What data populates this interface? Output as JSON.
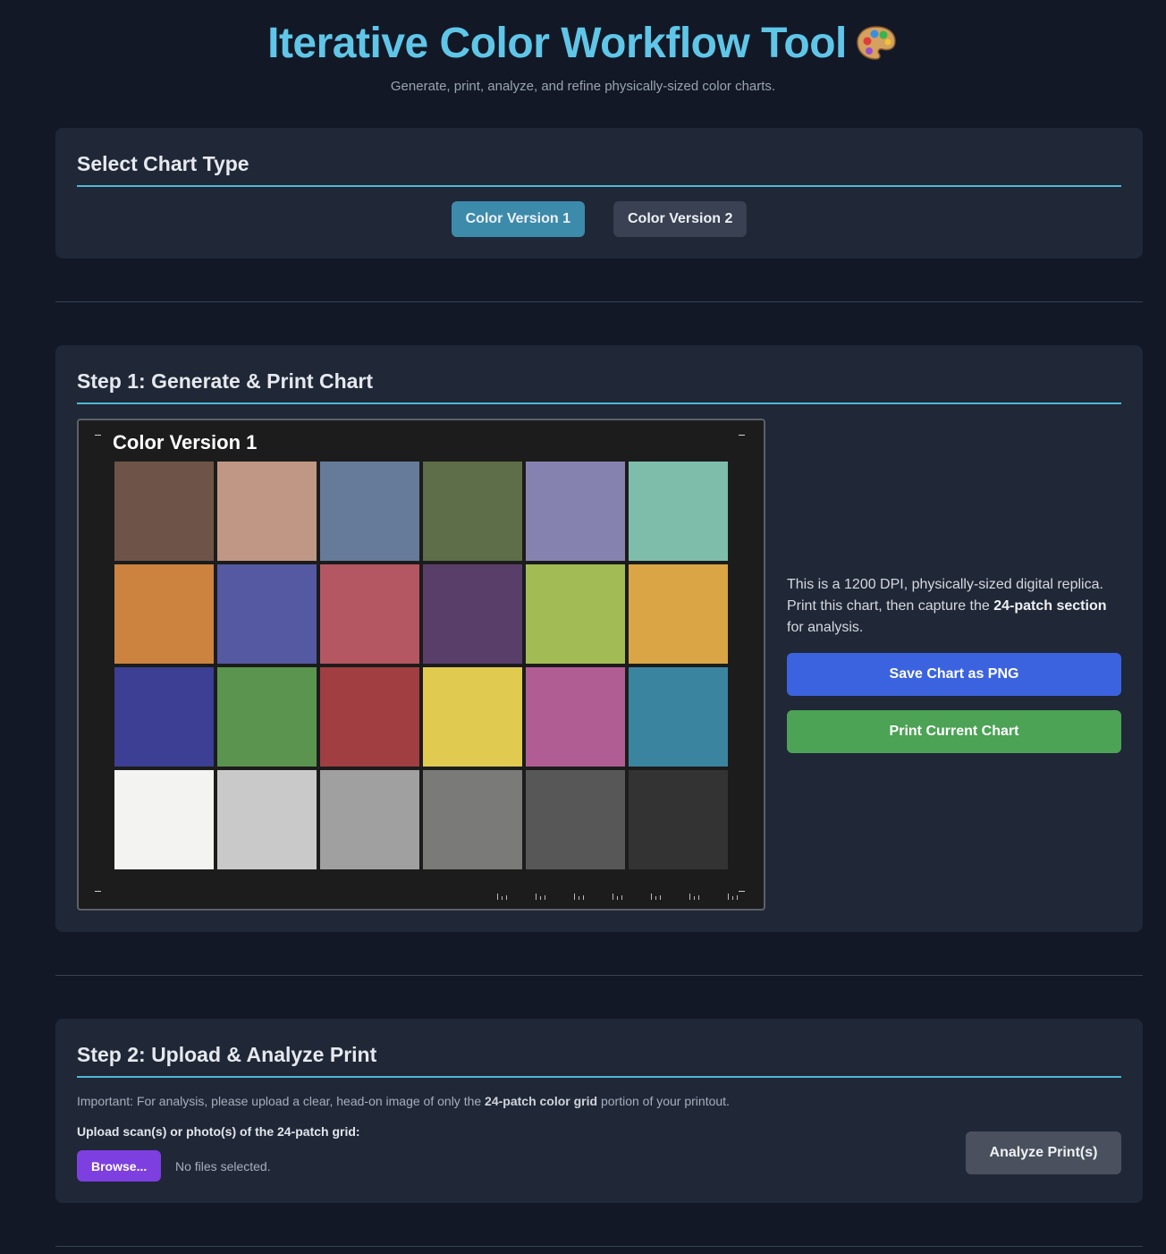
{
  "header": {
    "title": "Iterative Color Workflow Tool",
    "title_icon": "palette-icon",
    "subtitle": "Generate, print, analyze, and refine physically-sized color charts."
  },
  "chart_type": {
    "heading": "Select Chart Type",
    "options": [
      {
        "label": "Color Version 1",
        "selected": true
      },
      {
        "label": "Color Version 2",
        "selected": false
      }
    ]
  },
  "step1": {
    "heading": "Step 1: Generate & Print Chart",
    "chart_name": "Color Version 1",
    "patches": [
      "#6e5448",
      "#c09684",
      "#667b9a",
      "#5e6e48",
      "#8682b0",
      "#7fbdab",
      "#cc8340",
      "#5459a2",
      "#b45762",
      "#5a3e6a",
      "#a2bb55",
      "#d9a545",
      "#3c3f93",
      "#5b944f",
      "#a13e42",
      "#e1ca50",
      "#b05d94",
      "#3b84a0",
      "#f3f3f1",
      "#c9c9c9",
      "#a0a0a0",
      "#7a7a78",
      "#575757",
      "#333333"
    ],
    "description_prefix": "This is a 1200 DPI, physically-sized digital replica. Print this chart, then capture the ",
    "description_bold": "24-patch section",
    "description_suffix": " for analysis.",
    "save_label": "Save Chart as PNG",
    "print_label": "Print Current Chart"
  },
  "step2": {
    "heading": "Step 2: Upload & Analyze Print",
    "note_prefix": "Important: For analysis, please upload a clear, head-on image of only the ",
    "note_bold": "24-patch color grid",
    "note_suffix": " portion of your printout.",
    "upload_label": "Upload scan(s) or photo(s) of the 24-patch grid:",
    "browse_label": "Browse...",
    "file_status": "No files selected.",
    "analyze_label": "Analyze Print(s)"
  },
  "colors": {
    "accent": "#5fc6e8",
    "selected_tab": "#3c8bab",
    "save_button": "#3c63df",
    "print_button": "#4ca255",
    "browse_button": "#7d3fe0"
  }
}
